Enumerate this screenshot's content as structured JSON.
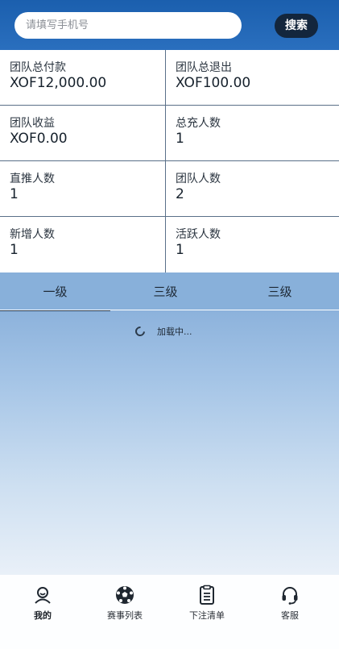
{
  "search": {
    "placeholder": "请填写手机号",
    "button_label": "搜索"
  },
  "stats": [
    {
      "label": "团队总付款",
      "value": "XOF12,000.00"
    },
    {
      "label": "团队总退出",
      "value": "XOF100.00"
    },
    {
      "label": "团队收益",
      "value": "XOF0.00"
    },
    {
      "label": "总充人数",
      "value": "1"
    },
    {
      "label": "直推人数",
      "value": "1"
    },
    {
      "label": "团队人数",
      "value": "2"
    },
    {
      "label": "新增人数",
      "value": "1"
    },
    {
      "label": "活跃人数",
      "value": "1"
    }
  ],
  "tabs": [
    {
      "label": "一级",
      "active": true
    },
    {
      "label": "三级",
      "active": false
    },
    {
      "label": "三级",
      "active": false
    }
  ],
  "loading": {
    "text": "加载中..."
  },
  "bottom_nav": [
    {
      "label": "我的",
      "icon": "user-icon",
      "active": true
    },
    {
      "label": "赛事列表",
      "icon": "soccer-ball-icon",
      "active": false
    },
    {
      "label": "下注清单",
      "icon": "clipboard-list-icon",
      "active": false
    },
    {
      "label": "客服",
      "icon": "headset-icon",
      "active": false
    }
  ],
  "colors": {
    "header_blue": "#1b5fae",
    "search_button": "#13263d",
    "tab_bar": "#88b0da"
  }
}
